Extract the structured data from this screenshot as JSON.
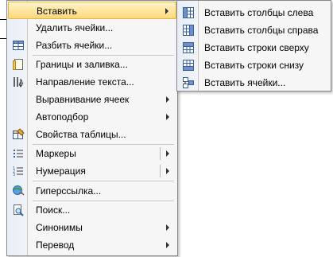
{
  "context_menu": {
    "items": [
      {
        "label": "Вставить",
        "arrow": true,
        "highlight": true
      },
      {
        "label": "Удалить ячейки..."
      },
      {
        "label": "Разбить ячейки..."
      },
      {
        "label": "Границы и заливка..."
      },
      {
        "label": "Направление текста..."
      },
      {
        "label": "Выравнивание ячеек",
        "arrow": true
      },
      {
        "label": "Автоподбор",
        "arrow": true
      },
      {
        "label": "Свойства таблицы..."
      },
      {
        "label": "Маркеры",
        "arrow": true,
        "split": true
      },
      {
        "label": "Нумерация",
        "arrow": true,
        "split": true
      },
      {
        "label": "Гиперссылка..."
      },
      {
        "label": "Поиск..."
      },
      {
        "label": "Синонимы",
        "arrow": true
      },
      {
        "label": "Перевод",
        "arrow": true
      }
    ]
  },
  "insert_submenu": {
    "items": [
      {
        "label": "Вставить столбцы слева"
      },
      {
        "label": "Вставить столбцы справа"
      },
      {
        "label": "Вставить строки сверху"
      },
      {
        "label": "Вставить строки снизу"
      },
      {
        "label": "Вставить ячейки..."
      }
    ]
  },
  "colors": {
    "highlight_top": "#fff4c9",
    "highlight_bottom": "#ffd87a",
    "menu_bg": "#f6f6f6",
    "gutter": "#e8eef7"
  }
}
